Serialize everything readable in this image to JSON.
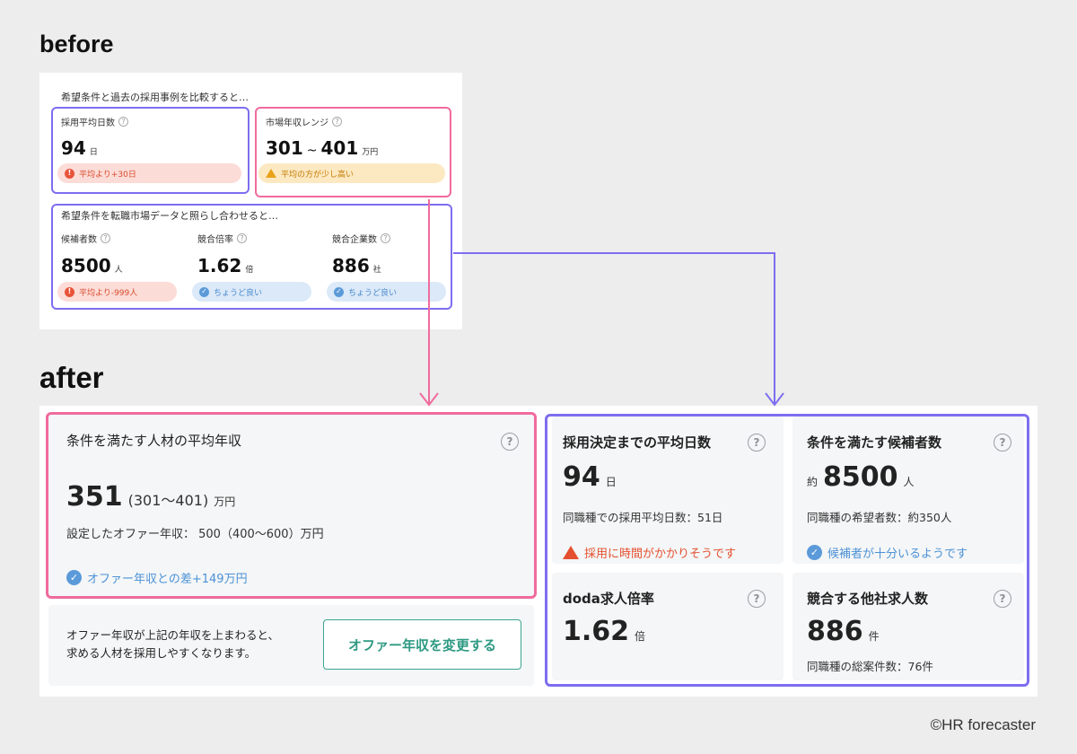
{
  "headings": {
    "before": "before",
    "after": "after"
  },
  "before": {
    "intro_1": "希望条件と過去の採用事例を比較すると…",
    "intro_2": "希望条件を転職市場データと照らし合わせると…",
    "help_glyph": "?",
    "avg_days": {
      "label": "採用平均日数",
      "value": "94",
      "unit": "日",
      "note": "平均より+30日"
    },
    "salary_range": {
      "label": "市場年収レンジ",
      "value_low": "301",
      "separator": "~",
      "value_high": "401",
      "unit": "万円",
      "note": "平均の方が少し高い"
    },
    "candidates": {
      "label": "候補者数",
      "value": "8500",
      "unit": "人",
      "note": "平均より-999人"
    },
    "competition_ratio": {
      "label": "競合倍率",
      "value": "1.62",
      "unit": "倍",
      "note": "ちょうど良い"
    },
    "competitor_count": {
      "label": "競合企業数",
      "value": "886",
      "unit": "社",
      "note": "ちょうど良い"
    }
  },
  "after": {
    "help_glyph": "?",
    "salary_card": {
      "title": "条件を満たす人材の平均年収",
      "value": "351",
      "range": "(301〜401)",
      "unit": "万円",
      "offer_line": "設定したオファー年収： 500（400〜600）万円",
      "note": "オファー年収との差+149万円"
    },
    "cta": {
      "text_line1": "オファー年収が上記の年収を上まわると、",
      "text_line2": "求める人材を採用しやすくなります。",
      "button_label": "オファー年収を変更する"
    },
    "avg_days_card": {
      "title": "採用決定までの平均日数",
      "value": "94",
      "unit": "日",
      "sub": "同職種での採用平均日数：51日",
      "note": "採用に時間がかかりそうです"
    },
    "candidates_card": {
      "title": "条件を満たす候補者数",
      "prefix": "約",
      "value": "8500",
      "unit": "人",
      "sub": "同職種の希望者数：約350人",
      "note": "候補者が十分いるようです"
    },
    "ratio_card": {
      "title": "doda求人倍率",
      "value": "1.62",
      "unit": "倍"
    },
    "competitors_card": {
      "title": "競合する他社求人数",
      "value": "886",
      "unit": "件",
      "sub": "同職種の総案件数：76件"
    }
  },
  "colors": {
    "pink_highlight": "#f06b9e",
    "purple_highlight": "#7d6ef0",
    "cta_green": "#2e9a83",
    "warning_red": "#e4502f",
    "ok_blue": "#4c91d6"
  },
  "copyright": "©HR forecaster"
}
